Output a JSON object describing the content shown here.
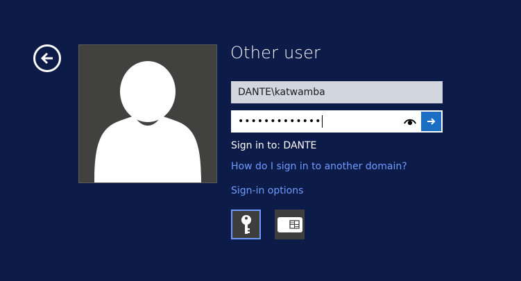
{
  "page": {
    "title": "Other user"
  },
  "form": {
    "username_value": "DANTE\\katwamba",
    "password_masked": "•••••••••••••",
    "signin_to_text": "Sign in to: DANTE"
  },
  "links": {
    "other_domain": "How do I sign in to another domain?",
    "signin_options": "Sign-in options"
  },
  "sign_in_options": [
    {
      "name": "password",
      "icon": "key-icon",
      "selected": true
    },
    {
      "name": "smart-card",
      "icon": "smart-card-icon",
      "selected": false
    }
  ],
  "colors": {
    "background": "#0d1b49",
    "avatar_tile": "#41423f",
    "link": "#6f9bff",
    "submit_button": "#1a6fc4",
    "username_field": "#d2d6df"
  },
  "icons": {
    "back": "back-arrow-icon",
    "reveal": "eye-icon",
    "submit": "arrow-right-icon",
    "avatar": "user-silhouette-icon"
  }
}
